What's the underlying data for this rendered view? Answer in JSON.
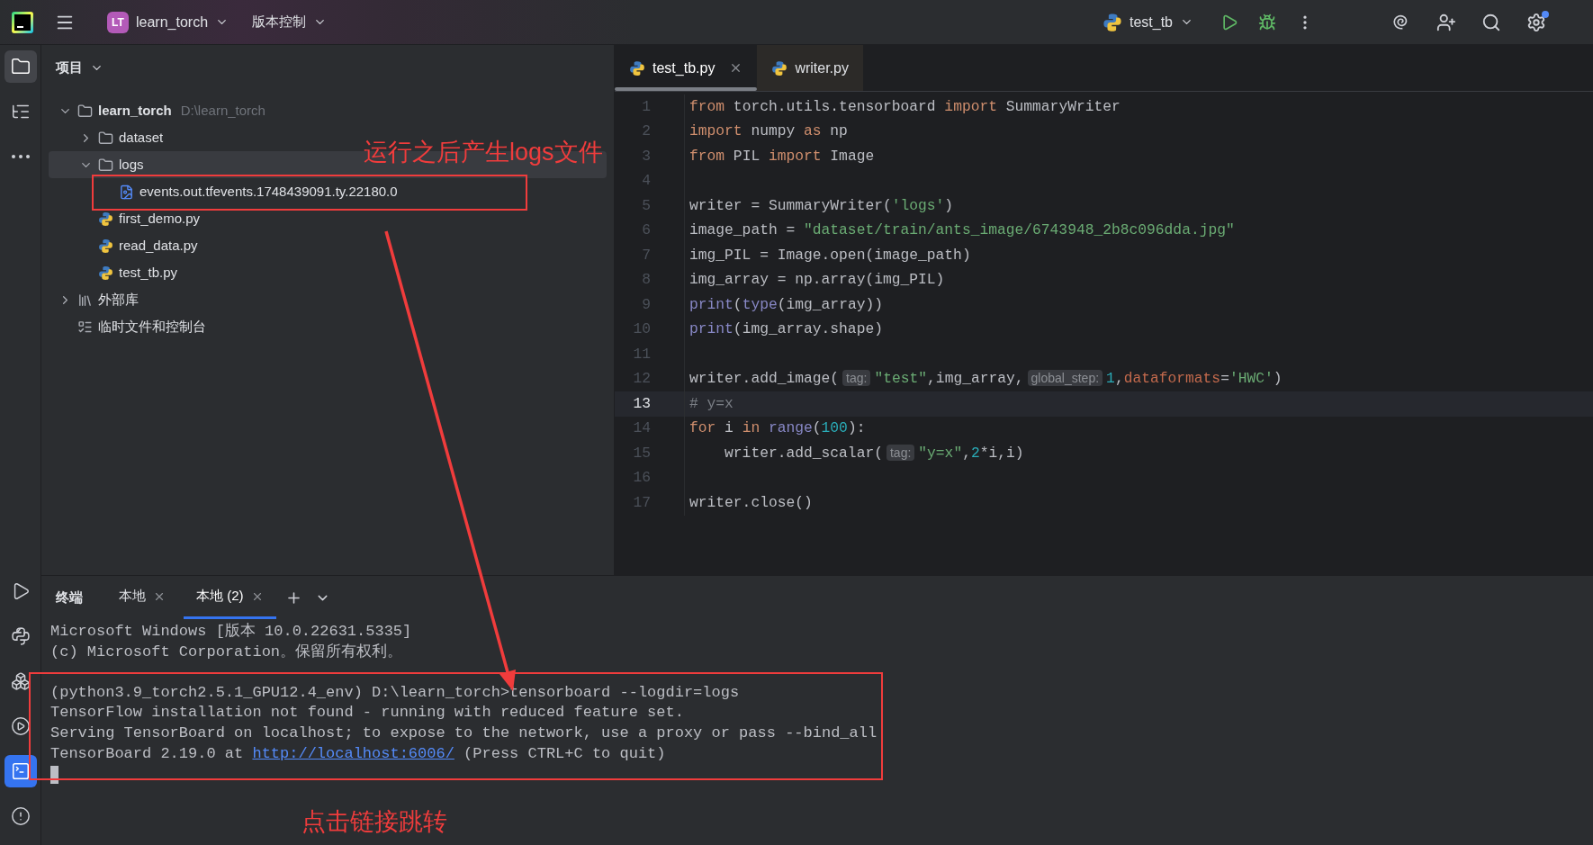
{
  "top_bar": {
    "project_badge": "LT",
    "project_name": "learn_torch",
    "vcs_menu": "版本控制",
    "run_config": "test_tb",
    "settings_notification": true
  },
  "tool_strip": {
    "top": [
      {
        "kind": "project",
        "selected": true
      },
      {
        "kind": "structure",
        "selected": false
      },
      {
        "kind": "more",
        "selected": false
      }
    ],
    "bottom": [
      {
        "kind": "run",
        "selected": false
      },
      {
        "kind": "python-console",
        "selected": false
      },
      {
        "kind": "packages",
        "selected": false
      },
      {
        "kind": "services",
        "selected": false
      },
      {
        "kind": "terminal",
        "selected": true
      },
      {
        "kind": "problems",
        "selected": false
      }
    ]
  },
  "project_panel": {
    "title": "项目",
    "tree": [
      {
        "name": "learn_torch",
        "path": "D:\\learn_torch",
        "kind": "folder",
        "expanded": true,
        "selected": false,
        "children": [
          {
            "name": "dataset",
            "kind": "folder",
            "expanded": false,
            "selected": false
          },
          {
            "name": "logs",
            "kind": "folder",
            "expanded": true,
            "selected": true,
            "children": [
              {
                "name": "events.out.tfevents.1748439091.ty.22180.0",
                "kind": "image-file",
                "selected": false
              }
            ]
          },
          {
            "name": "first_demo.py",
            "kind": "python-file",
            "selected": false
          },
          {
            "name": "read_data.py",
            "kind": "python-file",
            "selected": false
          },
          {
            "name": "test_tb.py",
            "kind": "python-file",
            "selected": false
          }
        ]
      },
      {
        "name": "外部库",
        "kind": "library",
        "expanded": false,
        "selected": false
      },
      {
        "name": "临时文件和控制台",
        "kind": "scratch",
        "selected": false
      }
    ]
  },
  "editor": {
    "tabs": [
      {
        "label": "test_tb.py",
        "selected": true,
        "closable": true
      },
      {
        "label": "writer.py",
        "selected": false,
        "closable": false
      }
    ],
    "lines": [
      {
        "number": "1",
        "current": false,
        "tokens": [
          {
            "kind": "keyword",
            "text": "from"
          },
          {
            "kind": "plain",
            "text": " torch.utils.tensorboard "
          },
          {
            "kind": "keyword",
            "text": "import"
          },
          {
            "kind": "plain",
            "text": " SummaryWriter"
          }
        ]
      },
      {
        "number": "2",
        "current": false,
        "tokens": [
          {
            "kind": "keyword",
            "text": "import"
          },
          {
            "kind": "plain",
            "text": " numpy "
          },
          {
            "kind": "keyword",
            "text": "as"
          },
          {
            "kind": "plain",
            "text": " np"
          }
        ]
      },
      {
        "number": "3",
        "current": false,
        "tokens": [
          {
            "kind": "keyword",
            "text": "from"
          },
          {
            "kind": "plain",
            "text": " PIL "
          },
          {
            "kind": "keyword",
            "text": "import"
          },
          {
            "kind": "plain",
            "text": " Image"
          }
        ]
      },
      {
        "number": "4",
        "current": false
      },
      {
        "number": "5",
        "current": false,
        "tokens": [
          {
            "kind": "plain",
            "text": "writer = SummaryWriter("
          },
          {
            "kind": "string",
            "text": "'logs'"
          },
          {
            "kind": "plain",
            "text": ")"
          }
        ]
      },
      {
        "number": "6",
        "current": false,
        "tokens": [
          {
            "kind": "plain",
            "text": "image_path = "
          },
          {
            "kind": "string",
            "text": "\"dataset/train/ants_image/6743948_2b8c096dda.jpg\""
          }
        ]
      },
      {
        "number": "7",
        "current": false,
        "tokens": [
          {
            "kind": "plain",
            "text": "img_PIL = Image.open(image_path)"
          }
        ]
      },
      {
        "number": "8",
        "current": false,
        "tokens": [
          {
            "kind": "plain",
            "text": "img_array = np.array(img_PIL)"
          }
        ]
      },
      {
        "number": "9",
        "current": false,
        "tokens": [
          {
            "kind": "builtin",
            "text": "print"
          },
          {
            "kind": "plain",
            "text": "("
          },
          {
            "kind": "builtin",
            "text": "type"
          },
          {
            "kind": "plain",
            "text": "(img_array))"
          }
        ]
      },
      {
        "number": "10",
        "current": false,
        "tokens": [
          {
            "kind": "builtin",
            "text": "print"
          },
          {
            "kind": "plain",
            "text": "(img_array.shape)"
          }
        ]
      },
      {
        "number": "11",
        "current": false
      },
      {
        "number": "12",
        "current": false,
        "tokens": [
          {
            "kind": "plain",
            "text": "writer.add_image("
          },
          {
            "kind": "hint",
            "text": "tag:"
          },
          {
            "kind": "string",
            "text": "\"test\""
          },
          {
            "kind": "plain",
            "text": ",img_array,"
          },
          {
            "kind": "hint",
            "text": "global_step:"
          },
          {
            "kind": "number",
            "text": "1"
          },
          {
            "kind": "plain",
            "text": ","
          },
          {
            "kind": "param",
            "text": "dataformats"
          },
          {
            "kind": "plain",
            "text": "="
          },
          {
            "kind": "string",
            "text": "'HWC'"
          },
          {
            "kind": "plain",
            "text": ")"
          }
        ]
      },
      {
        "number": "13",
        "current": true,
        "tokens": [
          {
            "kind": "comment",
            "text": "# y=x"
          }
        ]
      },
      {
        "number": "14",
        "current": false,
        "tokens": [
          {
            "kind": "keyword",
            "text": "for"
          },
          {
            "kind": "plain",
            "text": " i "
          },
          {
            "kind": "keyword",
            "text": "in"
          },
          {
            "kind": "builtin",
            "text": " range"
          },
          {
            "kind": "plain",
            "text": "("
          },
          {
            "kind": "number",
            "text": "100"
          },
          {
            "kind": "plain",
            "text": "):"
          }
        ]
      },
      {
        "number": "15",
        "current": false,
        "tokens": [
          {
            "kind": "plain",
            "text": "    writer.add_scalar("
          },
          {
            "kind": "hint",
            "text": "tag:"
          },
          {
            "kind": "string",
            "text": "\"y=x\""
          },
          {
            "kind": "plain",
            "text": ","
          },
          {
            "kind": "number",
            "text": "2"
          },
          {
            "kind": "plain",
            "text": "*i,i)"
          }
        ]
      },
      {
        "number": "16",
        "current": false
      },
      {
        "number": "17",
        "current": false,
        "tokens": [
          {
            "kind": "plain",
            "text": "writer.close()"
          }
        ]
      }
    ]
  },
  "terminal": {
    "title": "终端",
    "tabs": [
      {
        "label": "本地",
        "selected": false
      },
      {
        "label": "本地 (2)",
        "selected": true
      }
    ],
    "lines": [
      {
        "kind": "text",
        "segments": [
          {
            "kind": "plain",
            "text": "Microsoft Windows [版本 10.0.22631.5335]"
          }
        ]
      },
      {
        "kind": "text",
        "segments": [
          {
            "kind": "plain",
            "text": "(c) Microsoft Corporation。保留所有权利。"
          }
        ]
      },
      {
        "kind": "blank"
      },
      {
        "kind": "text",
        "segments": [
          {
            "kind": "plain",
            "text": "(python3.9_torch2.5.1_GPU12.4_env) D:\\learn_torch>tensorboard --logdir=logs"
          }
        ]
      },
      {
        "kind": "text",
        "segments": [
          {
            "kind": "plain",
            "text": "TensorFlow installation not found - running with reduced feature set."
          }
        ]
      },
      {
        "kind": "text",
        "segments": [
          {
            "kind": "plain",
            "text": "Serving TensorBoard on localhost; to expose to the network, use a proxy or pass --bind_all"
          }
        ]
      },
      {
        "kind": "text",
        "segments": [
          {
            "kind": "plain",
            "text": "TensorBoard 2.19.0 at "
          },
          {
            "kind": "link",
            "text": "http://localhost:6006/"
          },
          {
            "kind": "plain",
            "text": " (Press CTRL+C to quit)"
          }
        ]
      }
    ],
    "cursor": true
  },
  "annotations": {
    "top_note": "运行之后产生logs文件",
    "bottom_note": "点击链接跳转"
  }
}
